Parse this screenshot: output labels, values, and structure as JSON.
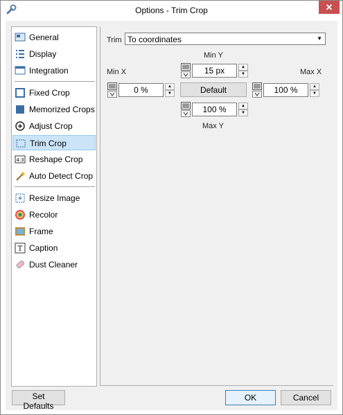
{
  "window": {
    "title": "Options - Trim Crop",
    "close_glyph": "✕"
  },
  "sidebar": {
    "groups": [
      [
        {
          "label": "General",
          "icon": "general-icon"
        },
        {
          "label": "Display",
          "icon": "display-icon"
        },
        {
          "label": "Integration",
          "icon": "integration-icon"
        }
      ],
      [
        {
          "label": "Fixed Crop",
          "icon": "fixed-crop-icon"
        },
        {
          "label": "Memorized Crops",
          "icon": "memorized-crops-icon"
        },
        {
          "label": "Adjust Crop",
          "icon": "adjust-crop-icon"
        },
        {
          "label": "Trim Crop",
          "icon": "trim-crop-icon",
          "selected": true
        },
        {
          "label": "Reshape Crop",
          "icon": "reshape-crop-icon"
        },
        {
          "label": "Auto Detect Crop",
          "icon": "auto-detect-crop-icon"
        }
      ],
      [
        {
          "label": "Resize Image",
          "icon": "resize-image-icon"
        },
        {
          "label": "Recolor",
          "icon": "recolor-icon"
        },
        {
          "label": "Frame",
          "icon": "frame-icon"
        },
        {
          "label": "Caption",
          "icon": "caption-icon"
        },
        {
          "label": "Dust Cleaner",
          "icon": "dust-cleaner-icon"
        }
      ]
    ]
  },
  "trim": {
    "label": "Trim",
    "mode": "To coordinates",
    "min_y_label": "Min Y",
    "min_y_value": "15 px",
    "min_x_label": "Min X",
    "min_x_value": "0 %",
    "max_x_label": "Max X",
    "max_x_value": "100 %",
    "max_y_label": "Max Y",
    "max_y_value": "100 %",
    "default_label": "Default"
  },
  "footer": {
    "set_defaults": "Set Defaults",
    "ok": "OK",
    "cancel": "Cancel"
  },
  "colors": {
    "selection_bg": "#cce4f7",
    "selection_border": "#99c9ef",
    "close_bg": "#c75050"
  }
}
